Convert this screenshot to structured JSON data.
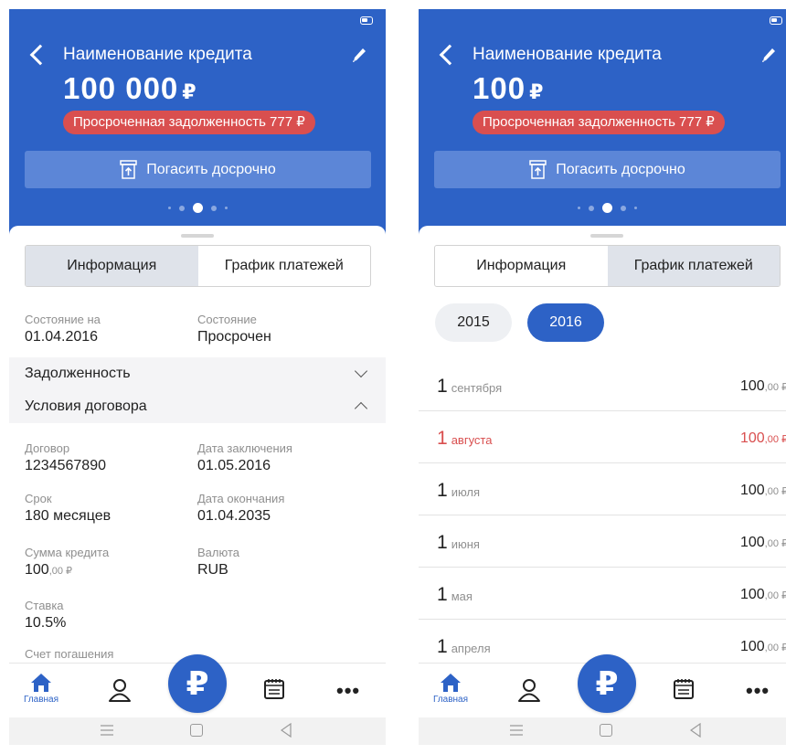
{
  "left": {
    "header": {
      "title": "Наименование кредита",
      "amount": "100 000",
      "currency": "₽",
      "overdue_label": "Просроченная задолженность 777 ₽",
      "repay_button": "Погасить досрочно",
      "pager_active_index": 2
    },
    "tabs": [
      "Информация",
      "График платежей"
    ],
    "active_tab": 0,
    "status": {
      "as_of_label": "Состояние на",
      "as_of_value": "01.04.2016",
      "state_label": "Состояние",
      "state_value": "Просрочен"
    },
    "sections": {
      "debt": "Задолженность",
      "terms": "Условия договора"
    },
    "terms": {
      "contract_label": "Договор",
      "contract_value": "1234567890",
      "signed_label": "Дата заключения",
      "signed_value": "01.05.2016",
      "term_label": "Срок",
      "term_value": "180 месяцев",
      "end_label": "Дата окончания",
      "end_value": "01.04.2035",
      "sum_label": "Сумма кредита",
      "sum_int": "100",
      "sum_dec": ",00 ₽",
      "currency_label": "Валюта",
      "currency_value": "RUB",
      "rate_label": "Ставка",
      "rate_value": "10.5%",
      "account_label": "Счет погашения"
    }
  },
  "right": {
    "header": {
      "title": "Наименование кредита",
      "amount": "100",
      "currency": "₽",
      "overdue_label": "Просроченная задолженность 777 ₽",
      "repay_button": "Погасить досрочно",
      "pager_active_index": 2
    },
    "tabs": [
      "Информация",
      "График платежей"
    ],
    "active_tab": 1,
    "years": [
      "2015",
      "2016"
    ],
    "selected_year": "2016",
    "payments": [
      {
        "day": "1",
        "month": "сентября",
        "amount": "100",
        "dec": ",00 ₽",
        "overdue": false
      },
      {
        "day": "1",
        "month": "августа",
        "amount": "100",
        "dec": ",00 ₽",
        "overdue": true
      },
      {
        "day": "1",
        "month": "июля",
        "amount": "100",
        "dec": ",00 ₽",
        "overdue": false
      },
      {
        "day": "1",
        "month": "июня",
        "amount": "100",
        "dec": ",00 ₽",
        "overdue": false
      },
      {
        "day": "1",
        "month": "мая",
        "amount": "100",
        "dec": ",00 ₽",
        "overdue": false
      },
      {
        "day": "1",
        "month": "апреля",
        "amount": "100",
        "dec": ",00 ₽",
        "overdue": false
      }
    ]
  },
  "nav": {
    "home_label": "Главная",
    "center_symbol": "₽",
    "more_symbol": "•••"
  },
  "icons": [
    "back-icon",
    "edit-icon",
    "battery-icon",
    "repay-icon",
    "home-icon",
    "person-icon",
    "ruble-icon",
    "calendar-icon",
    "more-icon",
    "menu-icon",
    "square-icon",
    "triangle-back-icon"
  ],
  "colors": {
    "primary": "#2d62c6",
    "overdue": "#d94f4f",
    "repay_button": "#5c86d7"
  }
}
